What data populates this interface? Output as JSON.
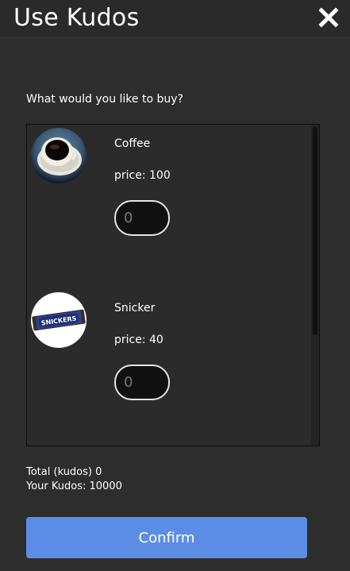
{
  "header": {
    "title": "Use Kudos",
    "close_icon": "close-icon"
  },
  "question": "What would you like to buy?",
  "items": [
    {
      "name": "Coffee",
      "price_text": "price: 100",
      "quantity_placeholder": "0",
      "image_icon": "coffee-cup-image"
    },
    {
      "name": "Snicker",
      "price_text": "price: 40",
      "quantity_placeholder": "0",
      "image_icon": "snickers-bar-image",
      "image_text": "SNICKERS"
    }
  ],
  "totals": {
    "total_text": "Total (kudos) 0",
    "your_kudos_text": "Your Kudos: 10000"
  },
  "confirm_label": "Confirm",
  "colors": {
    "background": "#2d2d2d",
    "accent": "#5b8de6",
    "text": "#ffffff"
  }
}
